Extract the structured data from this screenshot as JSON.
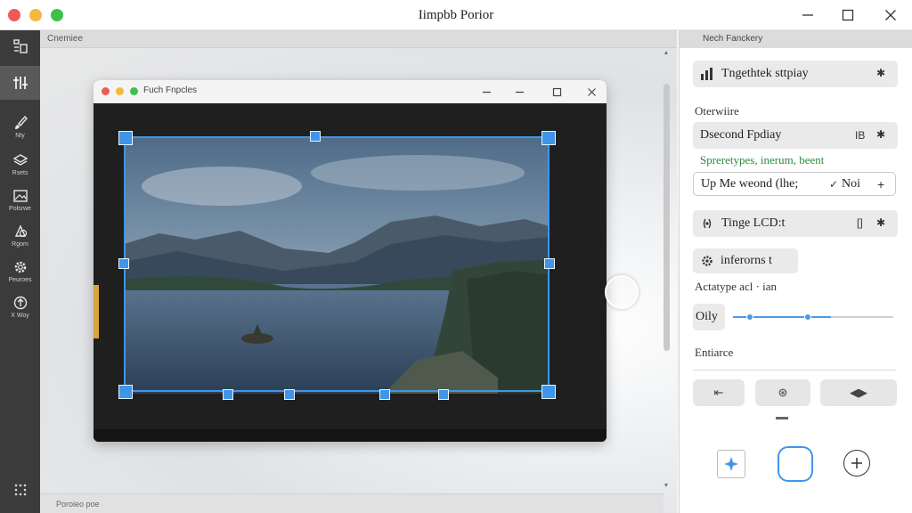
{
  "app": {
    "title": "Iimpbb Porior"
  },
  "sidebar": {
    "items": [
      {
        "label": ""
      },
      {
        "label": ""
      },
      {
        "label": "Nty"
      },
      {
        "label": "Rsets"
      },
      {
        "label": "Polsrwe"
      },
      {
        "label": "Rgom"
      },
      {
        "label": "Peuroes"
      },
      {
        "label": "X Woy"
      }
    ]
  },
  "canvas": {
    "header": "Cnemiee",
    "footer": "Poroieo poe",
    "inner_window": {
      "title": "Fuch Fnpcles"
    }
  },
  "panel": {
    "header": "Nech Fanckery",
    "row1": {
      "label": "Tngethtek sttpiay",
      "action": "✱"
    },
    "section_label": "Oterwiire",
    "row2": {
      "label": "Dsecond Fpdiay",
      "tag": "IB",
      "action": "✱"
    },
    "green_note": "Spreretypes, inerum, beent",
    "row3": {
      "label": "Up Me weond (lhe;",
      "mark": "✓",
      "value": "Noi",
      "action": "+"
    },
    "row4": {
      "label": "Tinge LCD:t",
      "tag": "[]",
      "action": "✱"
    },
    "row5": {
      "label": "inferorns t"
    },
    "sub_label": "Actatype acl · ian",
    "slider": {
      "label": "Oily",
      "value": 0.47
    },
    "section2_label": "Entiarce",
    "buttons": [
      {
        "label": "⇤"
      },
      {
        "label": "⊛"
      },
      {
        "label": "◀▶"
      }
    ]
  }
}
